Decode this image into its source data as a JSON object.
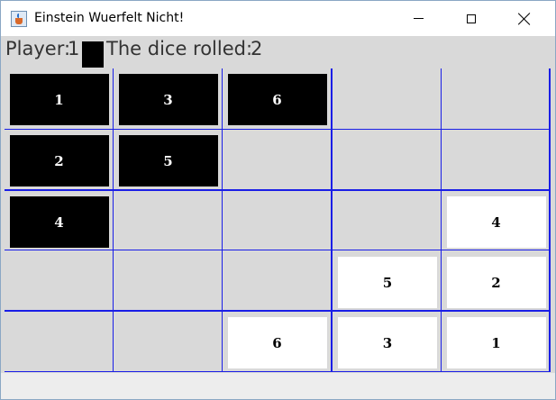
{
  "window": {
    "title": "Einstein Wuerfelt Nicht!",
    "icon": "java-cup-icon",
    "controls": [
      "minimize",
      "maximize",
      "close"
    ]
  },
  "status": {
    "player_label": "Player:",
    "player_value": "1",
    "player_color": "#000000",
    "dice_label": "The dice rolled:",
    "dice_value": "2"
  },
  "board": {
    "rows": 5,
    "cols": 5,
    "line_color": "#1a1ee6",
    "cell_color": "#d9d9d9",
    "pieces": [
      {
        "player": "black",
        "label": "1",
        "row": 0,
        "col": 0
      },
      {
        "player": "black",
        "label": "3",
        "row": 0,
        "col": 1
      },
      {
        "player": "black",
        "label": "6",
        "row": 0,
        "col": 2
      },
      {
        "player": "black",
        "label": "2",
        "row": 1,
        "col": 0
      },
      {
        "player": "black",
        "label": "5",
        "row": 1,
        "col": 1
      },
      {
        "player": "black",
        "label": "4",
        "row": 2,
        "col": 0
      },
      {
        "player": "white",
        "label": "4",
        "row": 2,
        "col": 4
      },
      {
        "player": "white",
        "label": "5",
        "row": 3,
        "col": 3
      },
      {
        "player": "white",
        "label": "2",
        "row": 3,
        "col": 4
      },
      {
        "player": "white",
        "label": "6",
        "row": 4,
        "col": 2
      },
      {
        "player": "white",
        "label": "3",
        "row": 4,
        "col": 3
      },
      {
        "player": "white",
        "label": "1",
        "row": 4,
        "col": 4
      }
    ]
  }
}
